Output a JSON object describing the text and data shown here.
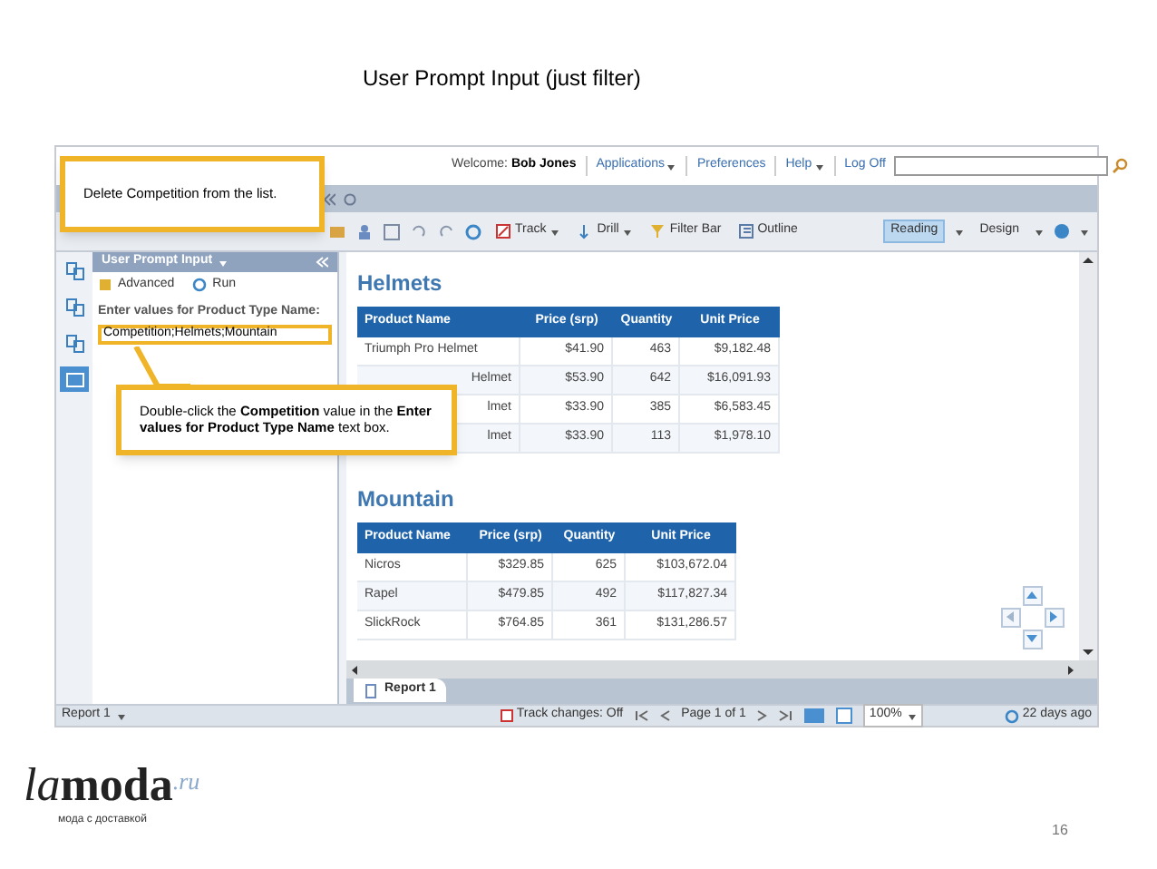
{
  "slide_title": "User Prompt Input (just filter)",
  "app": {
    "header": {
      "welcome_label": "Welcome:",
      "user": "Bob Jones",
      "menus": [
        {
          "label": "Applications",
          "dropdown": true
        },
        {
          "label": "Preferences",
          "dropdown": false
        },
        {
          "label": "Help",
          "dropdown": true
        },
        {
          "label": "Log Off",
          "dropdown": false
        }
      ]
    },
    "toolbar": {
      "buttons": [
        {
          "label": "Track",
          "dropdown": true
        },
        {
          "label": "Drill",
          "dropdown": true
        },
        {
          "label": "Filter Bar",
          "dropdown": false
        },
        {
          "label": "Outline",
          "dropdown": false
        }
      ],
      "view_modes": [
        {
          "label": "Reading",
          "selected": true
        },
        {
          "label": "Design",
          "selected": false
        }
      ]
    },
    "side_icons": [
      {
        "selected": false
      },
      {
        "selected": false
      },
      {
        "selected": false
      },
      {
        "selected": true
      }
    ],
    "prompt_panel": {
      "title": "User Prompt Input",
      "actions": [
        "Advanced",
        "Run"
      ],
      "field_label": "Enter values for Product Type Name:",
      "field_value": "Competition;Helmets;Mountain"
    },
    "sections": [
      {
        "title": "Helmets",
        "columns": [
          "Product Name",
          "Price (srp)",
          "Quantity",
          "Unit Price"
        ],
        "rows": [
          [
            "Triumph Pro Helmet",
            "$41.90",
            "463",
            "$9,182.48"
          ],
          [
            "Helmet",
            "$53.90",
            "642",
            "$16,091.93"
          ],
          [
            "lmet",
            "$33.90",
            "385",
            "$6,583.45"
          ],
          [
            "lmet",
            "$33.90",
            "113",
            "$1,978.10"
          ]
        ]
      },
      {
        "title": "Mountain",
        "columns": [
          "Product Name",
          "Price (srp)",
          "Quantity",
          "Unit Price"
        ],
        "rows": [
          [
            "Nicros",
            "$329.85",
            "625",
            "$103,672.04"
          ],
          [
            "Rapel",
            "$479.85",
            "492",
            "$117,827.34"
          ],
          [
            "SlickRock",
            "$764.85",
            "361",
            "$131,286.57"
          ]
        ]
      }
    ],
    "report_tab": "Report 1",
    "status_bar": {
      "report": "Report 1",
      "track_changes": "Track changes: Off",
      "page": "Page 1 of 1",
      "zoom": "100%",
      "updated": "22 days ago"
    },
    "callouts": [
      {
        "text": "Delete Competition from the list."
      },
      {
        "text": "Double-click the **Competition** value in the **Enter values for Product Type Name** text box."
      }
    ]
  },
  "footer": {
    "logo": {
      "italic": "la",
      "bold": "moda",
      "suffix": ".ru"
    },
    "tagline": "мода с доставкой",
    "page_number": "16"
  }
}
